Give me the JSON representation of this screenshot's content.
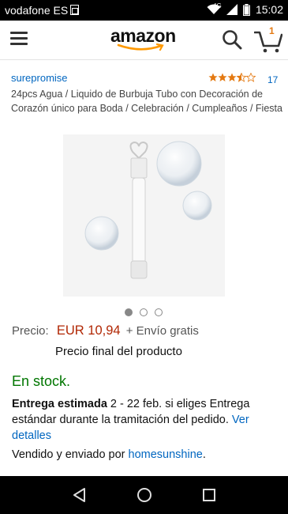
{
  "status_bar": {
    "carrier": "vodafone ES",
    "network": "4G",
    "time": "15:02"
  },
  "header": {
    "logo": "amazon",
    "cart_count": "1"
  },
  "product": {
    "brand": "surepromise",
    "rating": 3.5,
    "review_count": "17",
    "title": "24pcs Agua / Liquido de Burbuja Tubo con Decoración de Corazón único para Boda / Celebración / Cumpleaños / Fiesta",
    "image_count": 3,
    "active_image": 0
  },
  "pricing": {
    "label": "Precio:",
    "price": "EUR 10,94",
    "shipping": "+ Envío gratis",
    "final_note": "Precio final del producto"
  },
  "availability": {
    "stock": "En stock.",
    "delivery_label": "Entrega estimada",
    "delivery_text": " 2 - 22 feb. si eliges Entrega estándar durante la tramitación del pedido. ",
    "details_link": "Ver detalles"
  },
  "seller": {
    "prefix": "Vendido y enviado por ",
    "name": "homesunshine",
    "suffix": "."
  },
  "colors": {
    "link": "#0066c0",
    "price": "#b12704",
    "stock": "#007600",
    "rating": "#e47911"
  }
}
